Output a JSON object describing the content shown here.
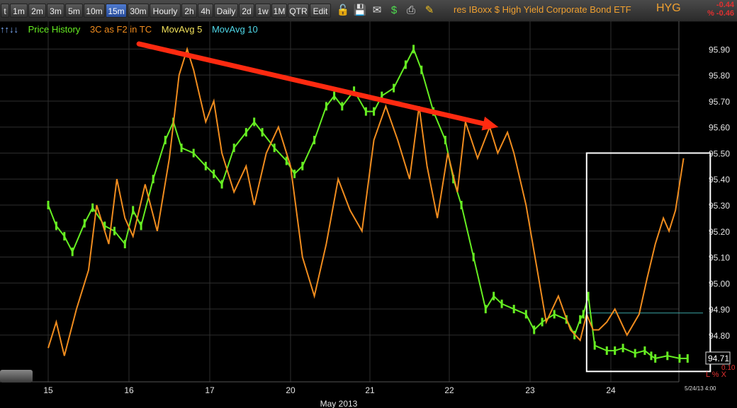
{
  "toolbar": {
    "buttons": [
      "t",
      "1m",
      "2m",
      "3m",
      "5m",
      "10m",
      "15m",
      "30m",
      "Hourly",
      "2h",
      "4h",
      "Daily",
      "2d",
      "1w",
      "1M",
      "QTR",
      "Edit"
    ],
    "active": "15m",
    "icons": [
      "lock-icon",
      "save-icon",
      "mail-icon",
      "dollar-icon",
      "print-icon",
      "pencil-icon"
    ]
  },
  "title": "res IBoxx $ High Yield Corporate Bond ETF",
  "symbol": "HYG",
  "change_abs": "-0.44",
  "change_pct": "% -0.46",
  "legend": [
    {
      "label": "Price History",
      "color": "#66ee22"
    },
    {
      "label": "3C as F2 in TC",
      "color": "#f08c1e"
    },
    {
      "label": "MovAvg 5",
      "color": "#f0e05a"
    },
    {
      "label": "MovAvg 10",
      "color": "#4fd8e8"
    }
  ],
  "legend_arrows": "↑↑↓↓",
  "corner_date": "5/24/13 4:00",
  "pct_label": "L % X",
  "colors": {
    "price": "#66ee22",
    "indicator": "#f08c1e",
    "arrow": "#ff2a10",
    "box": "#ffffff",
    "grid": "#2e2e2e",
    "axis_text": "#e6e6e6",
    "ref_line": "#3aa0a0"
  },
  "chart_data": {
    "type": "line",
    "title": "res IBoxx $ High Yield Corporate Bond ETF",
    "xlabel": "May 2013",
    "ylim": [
      94.62,
      95.98
    ],
    "y_ticks": [
      "95.90",
      "95.80",
      "95.70",
      "95.60",
      "95.50",
      "95.40",
      "95.30",
      "95.20",
      "95.10",
      "95.00",
      "94.90",
      "94.80"
    ],
    "y_extra_label": "0.10",
    "x_ticks": [
      "15",
      "16",
      "17",
      "20",
      "21",
      "22",
      "23",
      "24"
    ],
    "last_price": "94.71",
    "reference_line": 94.885,
    "series": [
      {
        "name": "Price History",
        "x": [
          0,
          0.1,
          0.2,
          0.3,
          0.45,
          0.55,
          0.7,
          0.82,
          0.95,
          1.05,
          1.15,
          1.3,
          1.45,
          1.55,
          1.65,
          1.8,
          1.95,
          2.05,
          2.15,
          2.3,
          2.45,
          2.55,
          2.65,
          2.8,
          2.95,
          3.05,
          3.15,
          3.3,
          3.45,
          3.55,
          3.65,
          3.8,
          3.95,
          4.05,
          4.15,
          4.3,
          4.45,
          4.55,
          4.65,
          4.8,
          4.95,
          5.05,
          5.15,
          5.3,
          5.45,
          5.55,
          5.65,
          5.8,
          5.95,
          6.05,
          6.15,
          6.3,
          6.45,
          6.55,
          6.62,
          6.66,
          6.72,
          6.8,
          6.95,
          7.05,
          7.15,
          7.3,
          7.42,
          7.5,
          7.55,
          7.7,
          7.85,
          7.95
        ],
        "values": [
          95.3,
          95.22,
          95.18,
          95.12,
          95.23,
          95.29,
          95.22,
          95.2,
          95.15,
          95.28,
          95.22,
          95.4,
          95.55,
          95.62,
          95.52,
          95.5,
          95.45,
          95.42,
          95.38,
          95.52,
          95.58,
          95.62,
          95.58,
          95.52,
          95.47,
          95.42,
          95.45,
          95.55,
          95.68,
          95.72,
          95.68,
          95.74,
          95.66,
          95.66,
          95.72,
          95.75,
          95.84,
          95.9,
          95.82,
          95.66,
          95.55,
          95.4,
          95.3,
          95.1,
          94.9,
          94.95,
          94.92,
          94.9,
          94.88,
          94.82,
          94.85,
          94.88,
          94.86,
          94.8,
          94.86,
          94.88,
          94.95,
          94.76,
          94.74,
          94.74,
          94.75,
          94.73,
          94.74,
          94.72,
          94.71,
          94.72,
          94.71,
          94.71
        ]
      },
      {
        "name": "3C as F2 in TC",
        "x": [
          0,
          0.1,
          0.2,
          0.35,
          0.5,
          0.6,
          0.75,
          0.85,
          0.95,
          1.05,
          1.2,
          1.35,
          1.5,
          1.62,
          1.72,
          1.8,
          1.95,
          2.05,
          2.15,
          2.3,
          2.45,
          2.55,
          2.7,
          2.85,
          3.0,
          3.15,
          3.3,
          3.45,
          3.6,
          3.75,
          3.9,
          4.05,
          4.2,
          4.35,
          4.5,
          4.62,
          4.72,
          4.85,
          4.98,
          5.1,
          5.2,
          5.35,
          5.5,
          5.6,
          5.72,
          5.8,
          5.95,
          6.05,
          6.2,
          6.35,
          6.5,
          6.62,
          6.7,
          6.78,
          6.85,
          6.95,
          7.05,
          7.2,
          7.35,
          7.45,
          7.55,
          7.65,
          7.72,
          7.8,
          7.9
        ],
        "values": [
          94.75,
          94.85,
          94.72,
          94.9,
          95.05,
          95.3,
          95.15,
          95.4,
          95.25,
          95.18,
          95.38,
          95.2,
          95.48,
          95.8,
          95.9,
          95.82,
          95.62,
          95.7,
          95.5,
          95.35,
          95.45,
          95.3,
          95.5,
          95.6,
          95.45,
          95.1,
          94.95,
          95.15,
          95.4,
          95.28,
          95.2,
          95.55,
          95.68,
          95.55,
          95.4,
          95.68,
          95.45,
          95.25,
          95.5,
          95.35,
          95.62,
          95.48,
          95.6,
          95.5,
          95.58,
          95.5,
          95.3,
          95.12,
          94.85,
          94.95,
          94.82,
          94.78,
          94.88,
          94.82,
          94.82,
          94.85,
          94.9,
          94.8,
          94.88,
          95.02,
          95.15,
          95.25,
          95.2,
          95.28,
          95.48
        ]
      }
    ],
    "annotations": [
      {
        "type": "arrow",
        "from": [
          1.65,
          95.92
        ],
        "to": [
          5.45,
          95.6
        ]
      },
      {
        "type": "box",
        "x": [
          6.7,
          7.95
        ],
        "y": [
          94.66,
          95.5
        ]
      }
    ]
  }
}
